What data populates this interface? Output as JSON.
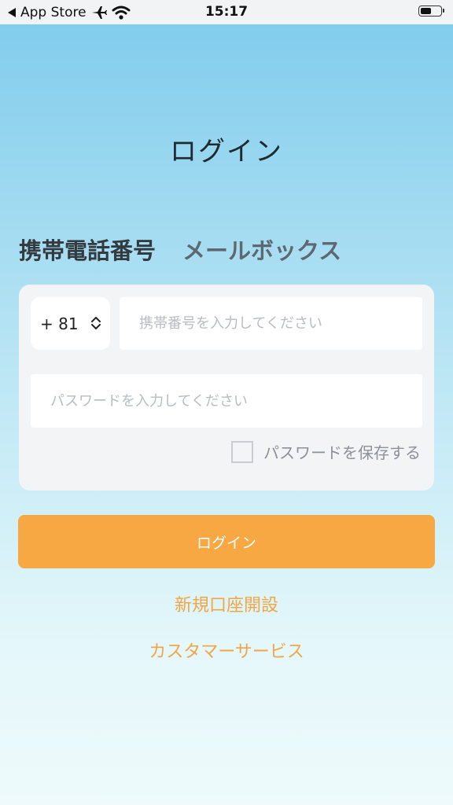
{
  "status_bar": {
    "back_app": "App Store",
    "time": "15:17",
    "battery_level": 0.55
  },
  "page": {
    "title": "ログイン"
  },
  "tabs": [
    {
      "label": "携帯電話番号",
      "active": true
    },
    {
      "label": "メールボックス",
      "active": false
    }
  ],
  "form": {
    "country_code": "+ 81",
    "phone_placeholder": "携帯番号を入力してください",
    "password_placeholder": "パスワードを入力してください",
    "save_password_label": "パスワードを保存する",
    "save_password_checked": false
  },
  "actions": {
    "login_label": "ログイン",
    "register_label": "新規口座開設",
    "customer_service_label": "カスタマーサービス"
  },
  "colors": {
    "accent": "#f8a843",
    "link": "#f0a646",
    "background_top": "#7ecbec",
    "background_bottom": "#eefafb"
  },
  "icons": [
    "back-arrow-icon",
    "airplane-icon",
    "wifi-icon",
    "battery-icon",
    "chevron-updown-icon"
  ]
}
